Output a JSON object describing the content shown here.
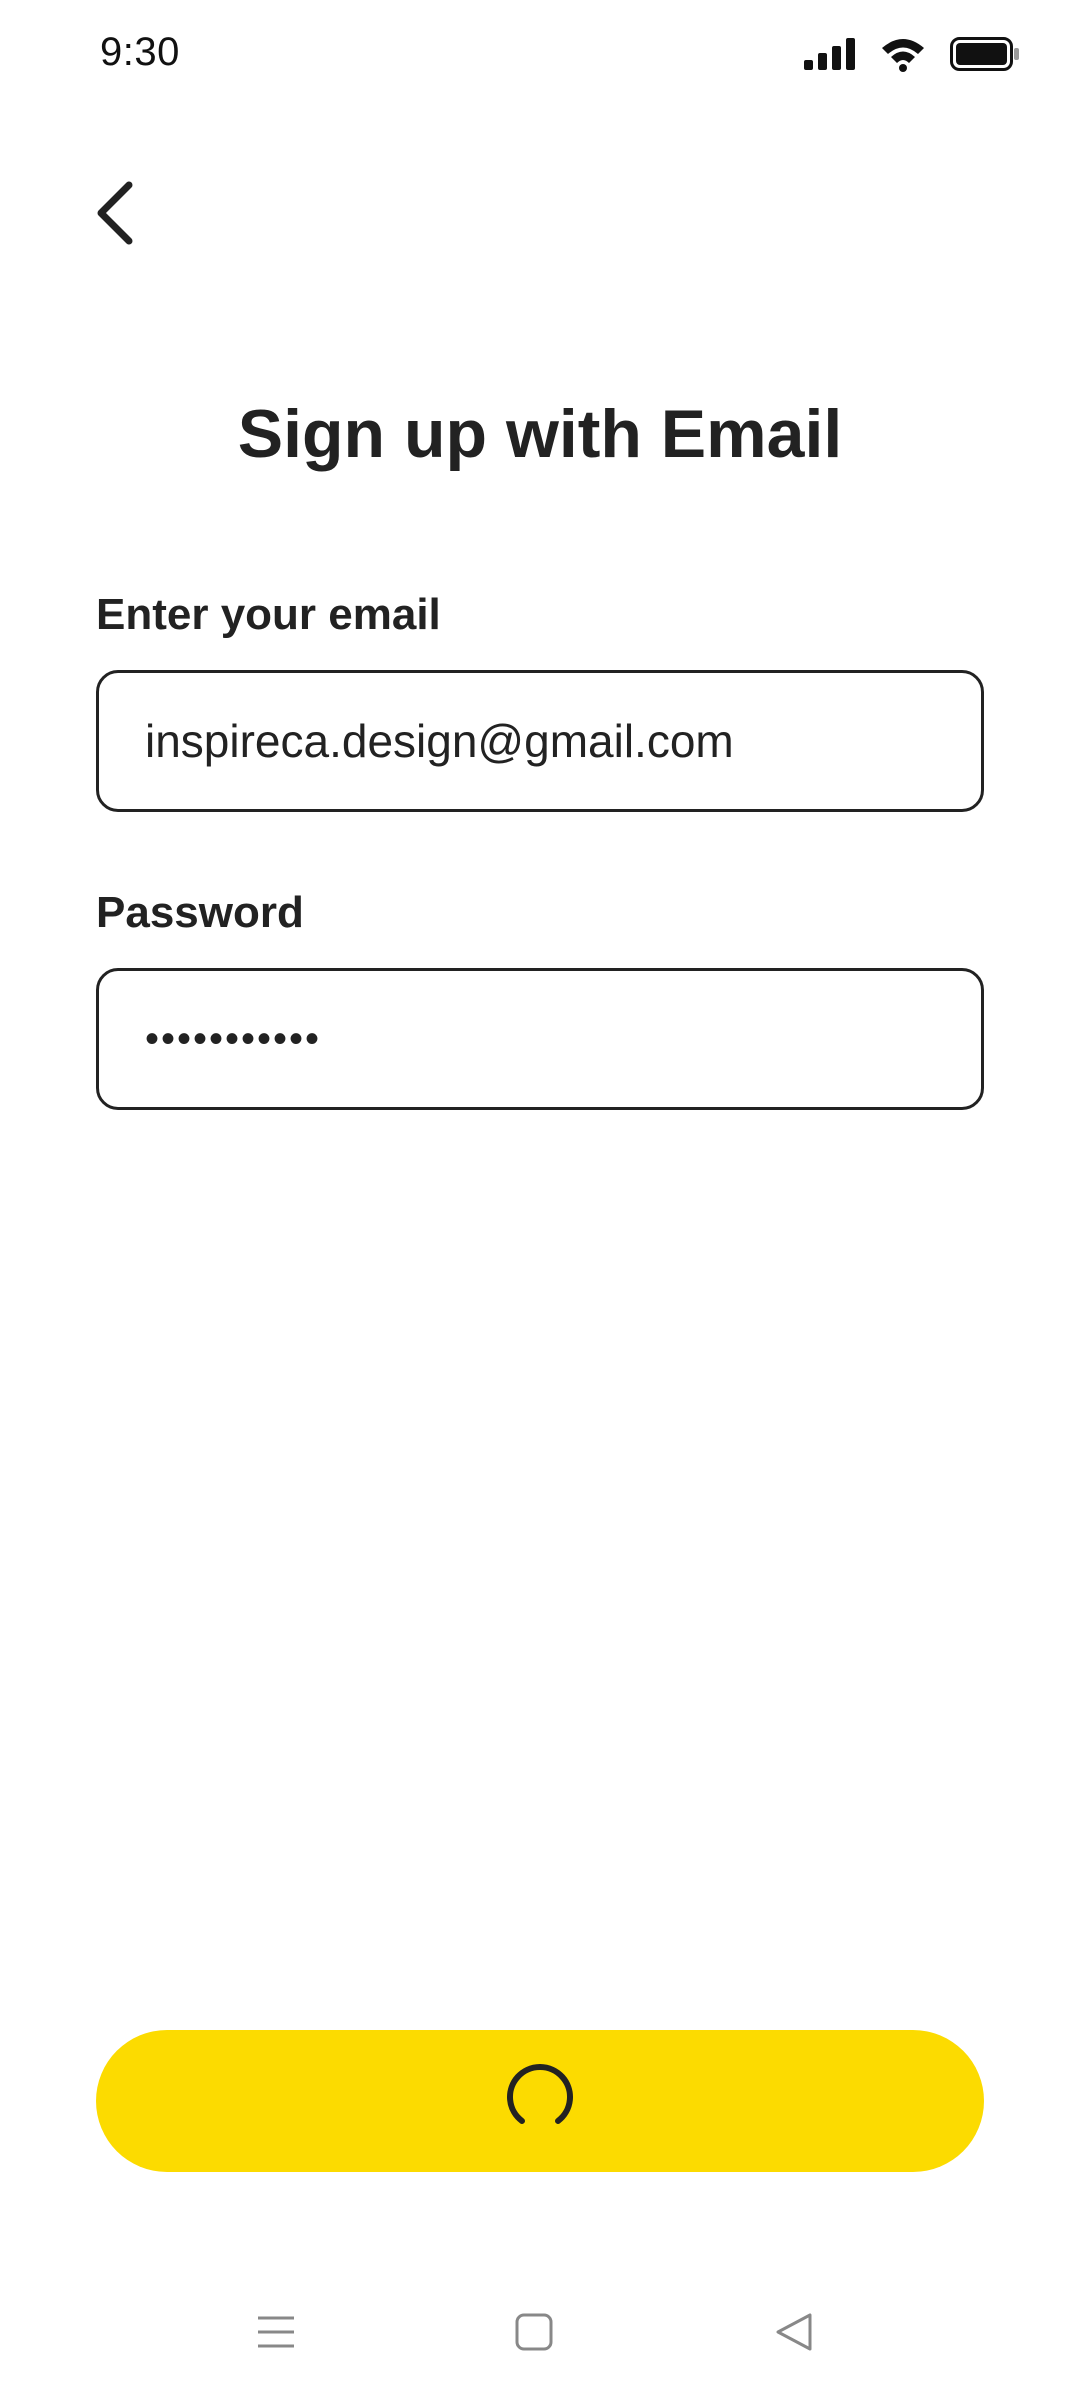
{
  "status_bar": {
    "time": "9:30",
    "icons": [
      "signal-icon",
      "wifi-icon",
      "battery-icon"
    ]
  },
  "header": {
    "back_icon": "chevron-left-icon"
  },
  "main": {
    "title": "Sign up with Email",
    "email": {
      "label": "Enter your email",
      "value": "inspireca.design@gmail.com"
    },
    "password": {
      "label": "Password",
      "value": "•••••••••••"
    }
  },
  "submit": {
    "state": "loading",
    "icon": "loading-spinner-icon",
    "color": "#FCDB00"
  },
  "nav_bar": {
    "icons": [
      "menu-icon",
      "home-square-icon",
      "back-triangle-icon"
    ]
  },
  "colors": {
    "accent": "#FCDB00",
    "text": "#222222",
    "background": "#FFFFFF"
  }
}
